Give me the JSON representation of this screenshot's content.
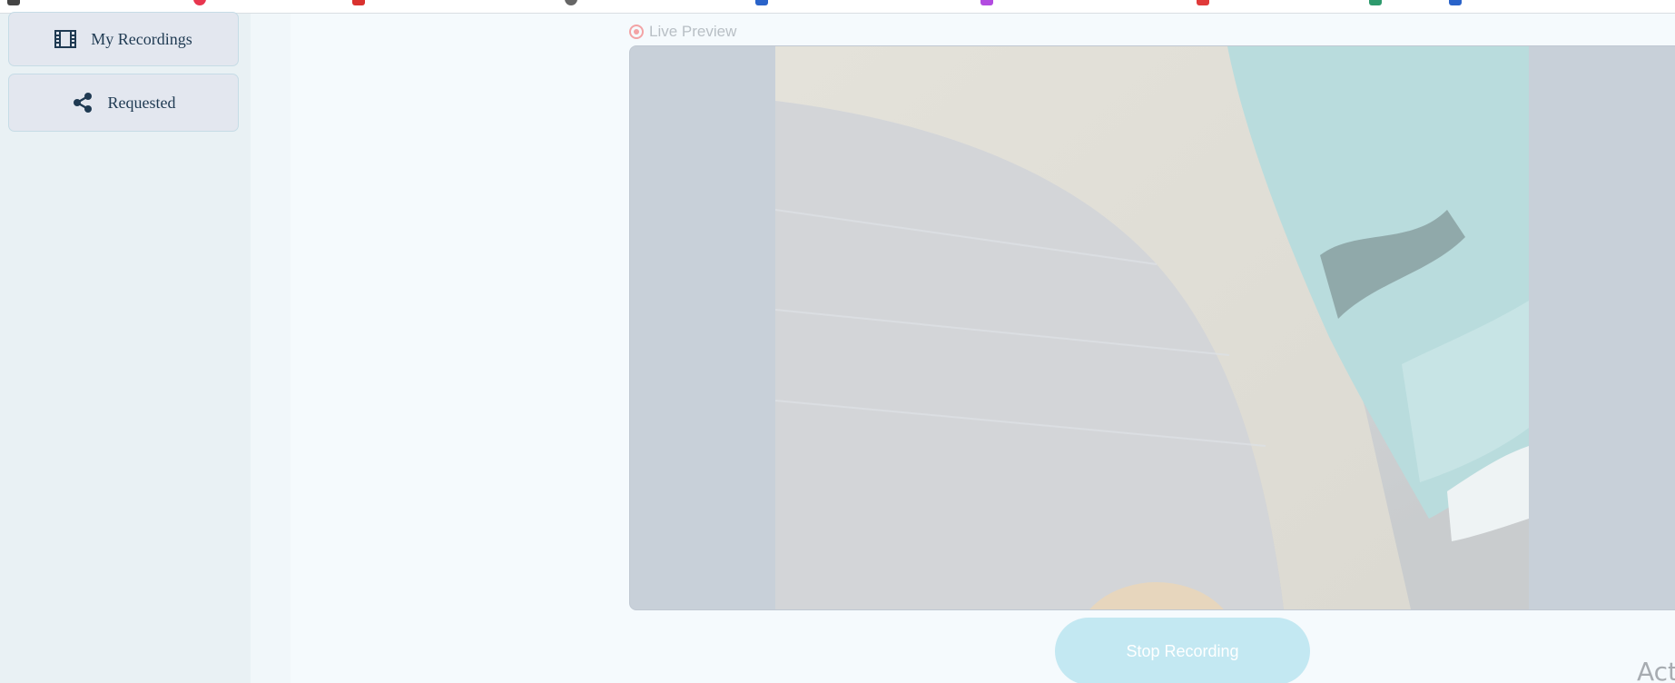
{
  "sidebar": {
    "items": [
      {
        "label": "My Recordings",
        "icon": "film-icon"
      },
      {
        "label": "Requested",
        "icon": "share-icon"
      }
    ]
  },
  "preview": {
    "label": "Live Preview",
    "status_color": "#f3a3a5"
  },
  "controls": {
    "stop_label": "Stop Recording",
    "accent": "#c3e8f2"
  },
  "watermark": {
    "text": "Activate Windows"
  }
}
